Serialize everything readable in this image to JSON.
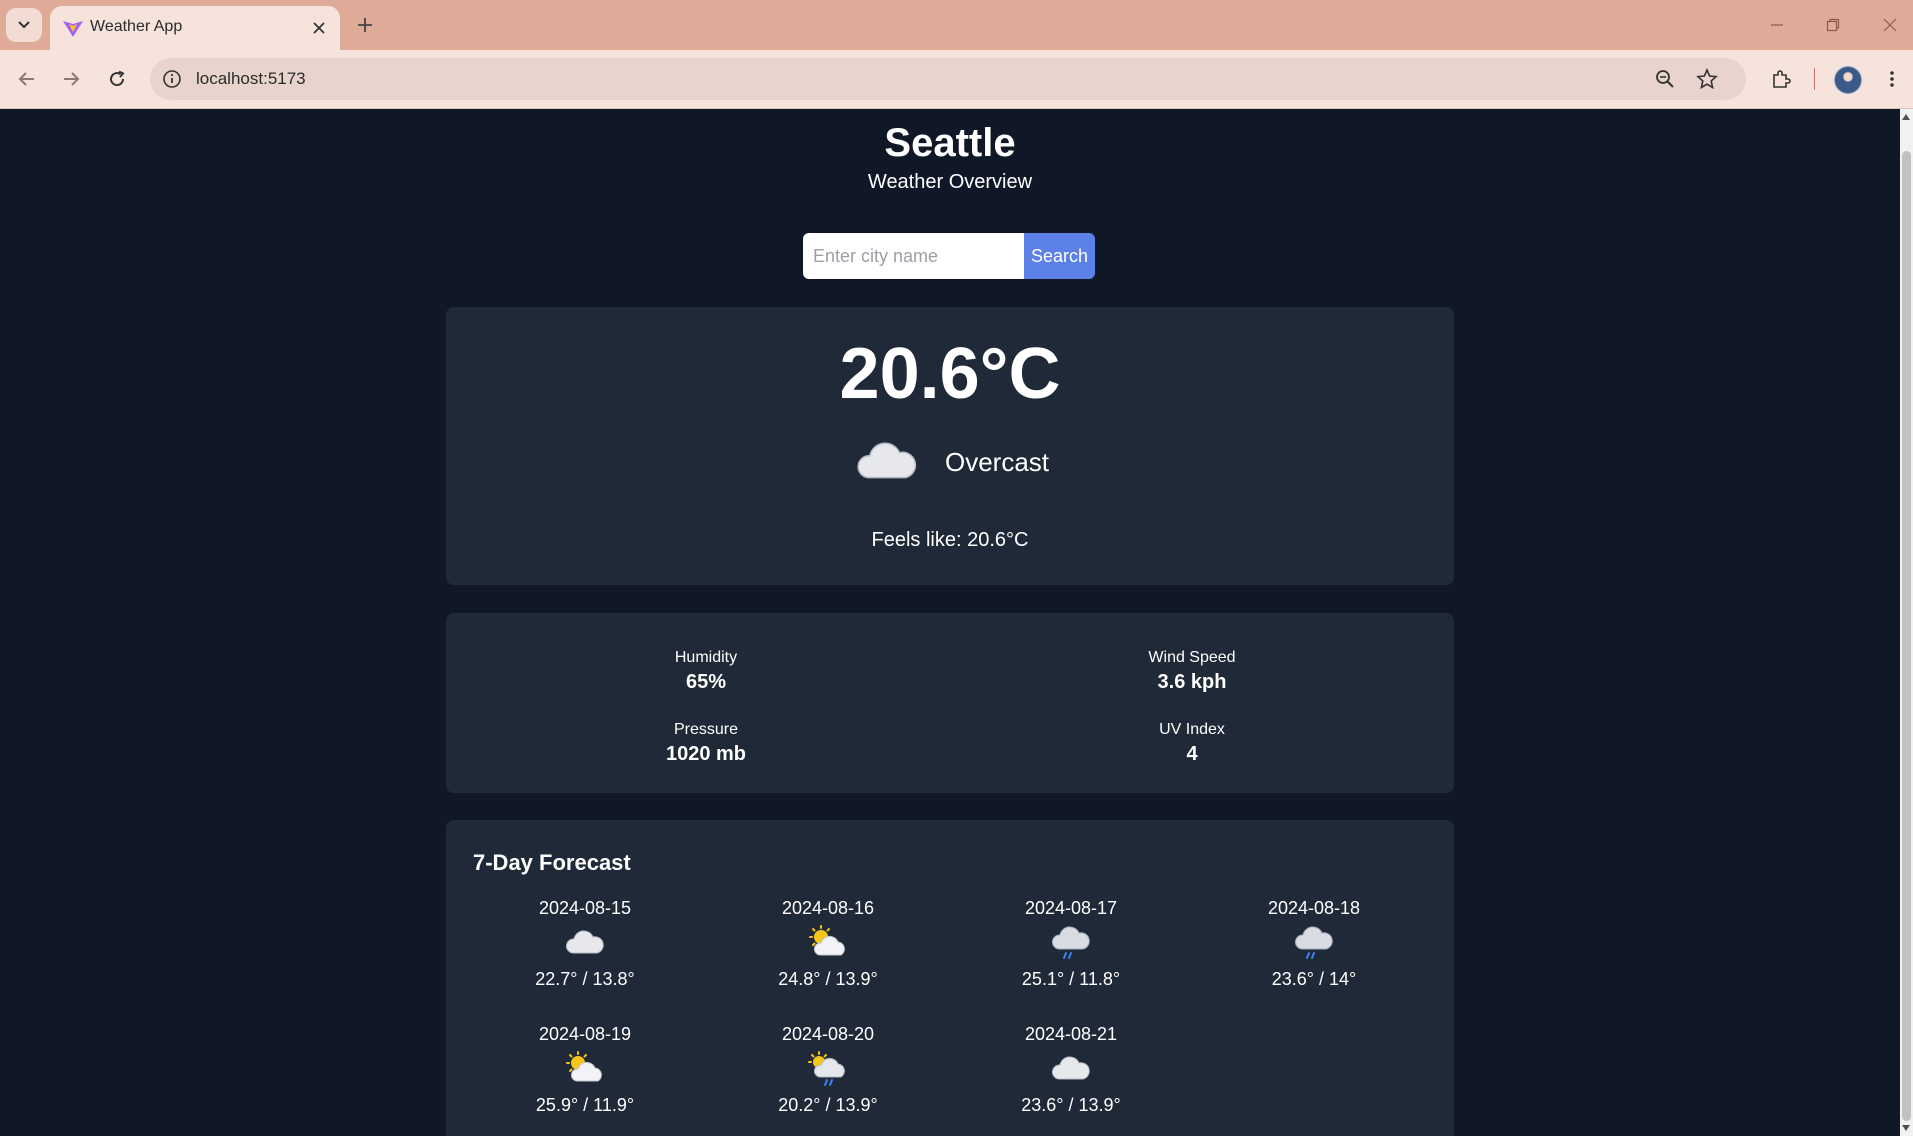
{
  "browser": {
    "tab_title": "Weather App",
    "url": "localhost:5173"
  },
  "header": {
    "city": "Seattle",
    "subtitle": "Weather Overview"
  },
  "search": {
    "placeholder": "Enter city name",
    "value": "",
    "button_label": "Search"
  },
  "current": {
    "temperature": "20.6°C",
    "condition": "Overcast",
    "icon": "cloud-icon",
    "feels_like": "Feels like: 20.6°C"
  },
  "details": {
    "humidity_label": "Humidity",
    "humidity_value": "65%",
    "wind_label": "Wind Speed",
    "wind_value": "3.6 kph",
    "pressure_label": "Pressure",
    "pressure_value": "1020 mb",
    "uv_label": "UV Index",
    "uv_value": "4"
  },
  "forecast": {
    "title": "7-Day Forecast",
    "days": [
      {
        "date": "2024-08-15",
        "icon": "cloud-icon",
        "range": "22.7° / 13.8°"
      },
      {
        "date": "2024-08-16",
        "icon": "partly-sunny-icon",
        "range": "24.8° / 13.9°"
      },
      {
        "date": "2024-08-17",
        "icon": "rain-cloud-icon",
        "range": "25.1° / 11.8°"
      },
      {
        "date": "2024-08-18",
        "icon": "rain-cloud-icon",
        "range": "23.6° / 14°"
      },
      {
        "date": "2024-08-19",
        "icon": "partly-sunny-icon",
        "range": "25.9° / 11.9°"
      },
      {
        "date": "2024-08-20",
        "icon": "sun-rain-cloud-icon",
        "range": "20.2° / 13.9°"
      },
      {
        "date": "2024-08-21",
        "icon": "cloud-icon",
        "range": "23.6° / 13.9°"
      }
    ]
  },
  "colors": {
    "page_bg": "#101827",
    "card_bg": "#1f2937",
    "accent": "#5b80e6",
    "chrome_tabbar": "#e0aa99",
    "chrome_toolbar": "#f6e3dc"
  }
}
